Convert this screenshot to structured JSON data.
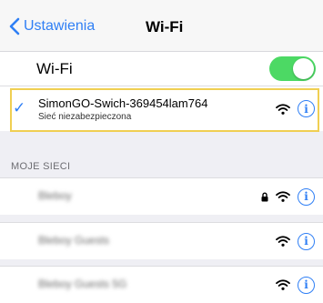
{
  "nav": {
    "back_label": "Ustawienia",
    "title": "Wi-Fi"
  },
  "wifi_toggle": {
    "label": "Wi-Fi",
    "enabled": true,
    "on_color": "#4cd964"
  },
  "current_network": {
    "name": "SimonGO-Swich-369454lam764",
    "status": "Sieć niezabezpieczona",
    "connected": true
  },
  "section": {
    "header": "MOJE SIECI"
  },
  "my_networks": [
    {
      "name": "Bleboy",
      "locked": true
    },
    {
      "name": "Bleboy Guests",
      "locked": false
    },
    {
      "name": "Bleboy Guests 5G",
      "locked": false
    }
  ],
  "icons": {
    "back": "chevron-left-icon",
    "check": "checkmark-icon",
    "wifi": "wifi-signal-icon",
    "info": "info-icon",
    "lock": "lock-icon"
  },
  "colors": {
    "accent": "#2f7ff5",
    "highlight": "#f0cf52",
    "background": "#efeff4"
  }
}
